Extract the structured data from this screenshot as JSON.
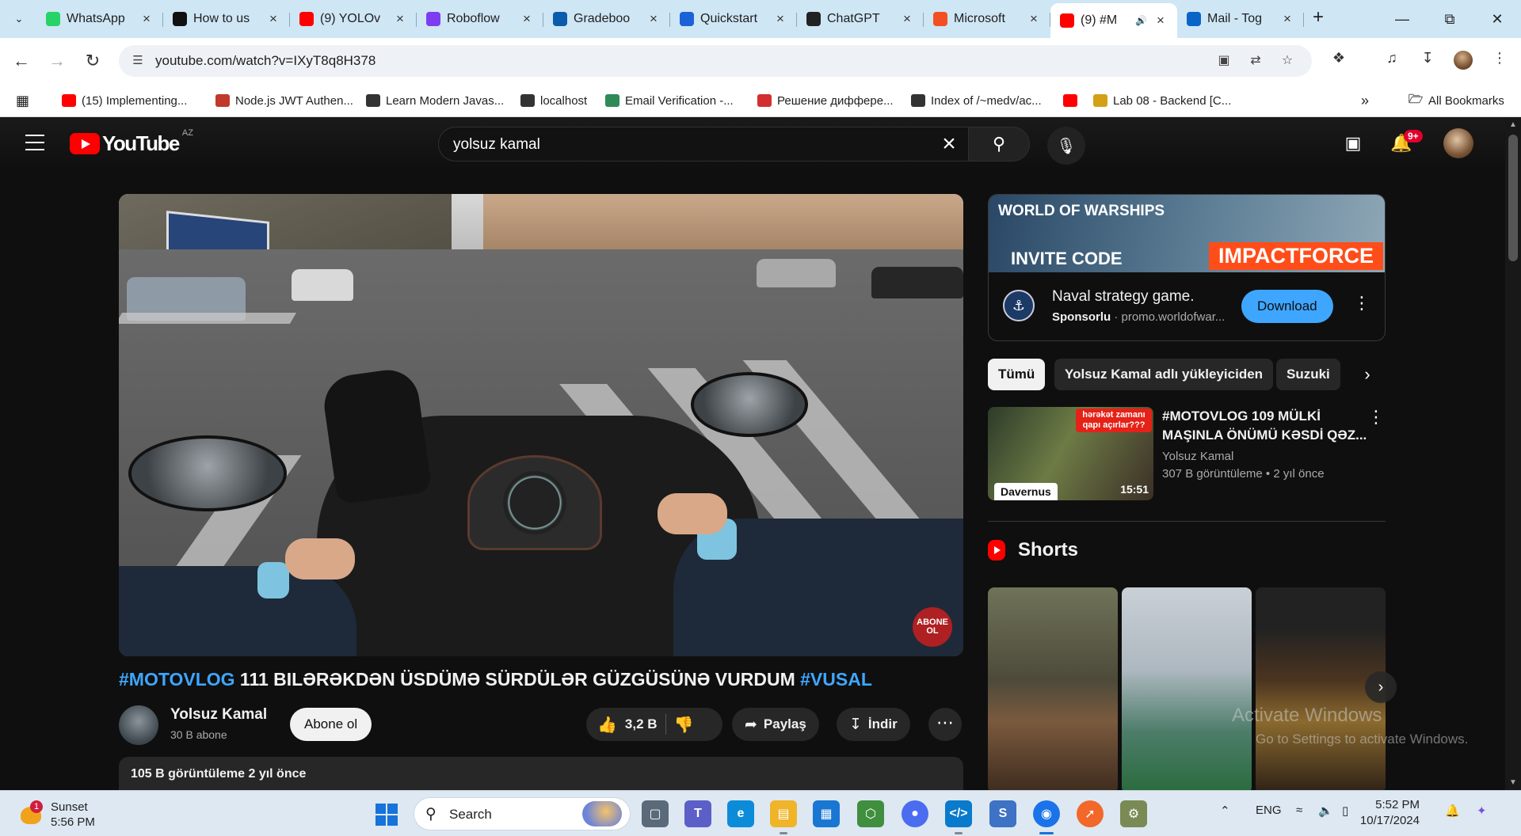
{
  "browser": {
    "tabs": [
      {
        "title": "WhatsApp",
        "fav_color": "#25d366",
        "fav_icon": "whatsapp-icon"
      },
      {
        "title": "How to us",
        "fav_color": "#111111",
        "fav_icon": "medium-icon"
      },
      {
        "title": "(9) YOLOv",
        "fav_color": "#ff0000",
        "fav_icon": "youtube-icon"
      },
      {
        "title": "Roboflow",
        "fav_color": "#7d3cf0",
        "fav_icon": "roboflow-icon"
      },
      {
        "title": "Gradeboo",
        "fav_color": "#0b5cad",
        "fav_icon": "gradebook-icon"
      },
      {
        "title": "Quickstart",
        "fav_color": "#1a62d6",
        "fav_icon": "quickstart-icon"
      },
      {
        "title": "ChatGPT",
        "fav_color": "#222222",
        "fav_icon": "chatgpt-icon"
      },
      {
        "title": "Microsoft",
        "fav_color": "#f25022",
        "fav_icon": "microsoft-icon"
      },
      {
        "title": "(9) #M",
        "fav_color": "#ff0000",
        "fav_icon": "youtube-icon",
        "active": true
      },
      {
        "title": "Mail - Tog",
        "fav_color": "#0a64c8",
        "fav_icon": "outlook-icon"
      }
    ],
    "url": "youtube.com/watch?v=IXyT8q8H378",
    "bookmarks": [
      {
        "label": "(15) Implementing...",
        "color": "#ff0000"
      },
      {
        "label": "Node.js JWT Authen...",
        "color": "#c0392b"
      },
      {
        "label": "Learn Modern Javas...",
        "color": "#333333"
      },
      {
        "label": "localhost",
        "color": "#333333"
      },
      {
        "label": "Email Verification -...",
        "color": "#2e8b57"
      },
      {
        "label": "Решение диффере...",
        "color": "#d32f2f"
      },
      {
        "label": "Index of /~medv/ac...",
        "color": "#333333"
      },
      {
        "label": "",
        "color": "#ff0000"
      },
      {
        "label": "Lab 08 - Backend [C...",
        "color": "#d4a017"
      }
    ],
    "all_bookmarks": "All Bookmarks"
  },
  "youtube": {
    "country": "AZ",
    "logo_text": "YouTube",
    "search_query": "yolsuz kamal",
    "notifications": "9+",
    "video": {
      "title_tag1": "#MOTOVLOG",
      "title_main": " 111 BILƏRƏKDƏN ÜSDÜMƏ SÜRDÜLƏR GÜZGÜSÜNƏ VURDUM ",
      "title_tag2": "#VUSAL",
      "watermark": "ABONE OL"
    },
    "channel": {
      "name": "Yolsuz Kamal",
      "subs": "30 B abone",
      "subscribe": "Abone ol"
    },
    "actions": {
      "likes": "3,2 B",
      "share": "Paylaş",
      "download": "İndir"
    },
    "description": {
      "meta": "105 B görüntüleme  2 yıl önce"
    },
    "ad": {
      "brand": "WORLD OF WARSHIPS",
      "invite": "INVITE CODE",
      "code": "IMPACTFORCE",
      "title": "Naval strategy game.",
      "sponsored": "Sponsorlu",
      "domain": " · promo.worldofwar...",
      "button": "Download"
    },
    "chips": [
      "Tümü",
      "Yolsuz Kamal adlı yükleyiciden",
      "Suzuki"
    ],
    "recommended": {
      "title": "#MOTOVLOG 109 MÜLKİ MAŞINLA ÖNÜMÜ KƏSDİ QƏZ...",
      "channel": "Yolsuz Kamal",
      "meta": "307 B görüntüleme  • 2 yıl önce",
      "duration": "15:51",
      "thumb_label": "Davernus",
      "thumb_overlay": "hərəkət zamanı qapı açırlar???"
    },
    "shorts_heading": "Shorts"
  },
  "windows_watermark": {
    "line1": "Activate Windows",
    "line2": "Go to Settings to activate Windows."
  },
  "taskbar": {
    "weather_title": "Sunset",
    "weather_time": "5:56 PM",
    "weather_badge": "1",
    "search": "Search",
    "lang": "ENG",
    "time": "5:52 PM",
    "date": "10/17/2024"
  }
}
